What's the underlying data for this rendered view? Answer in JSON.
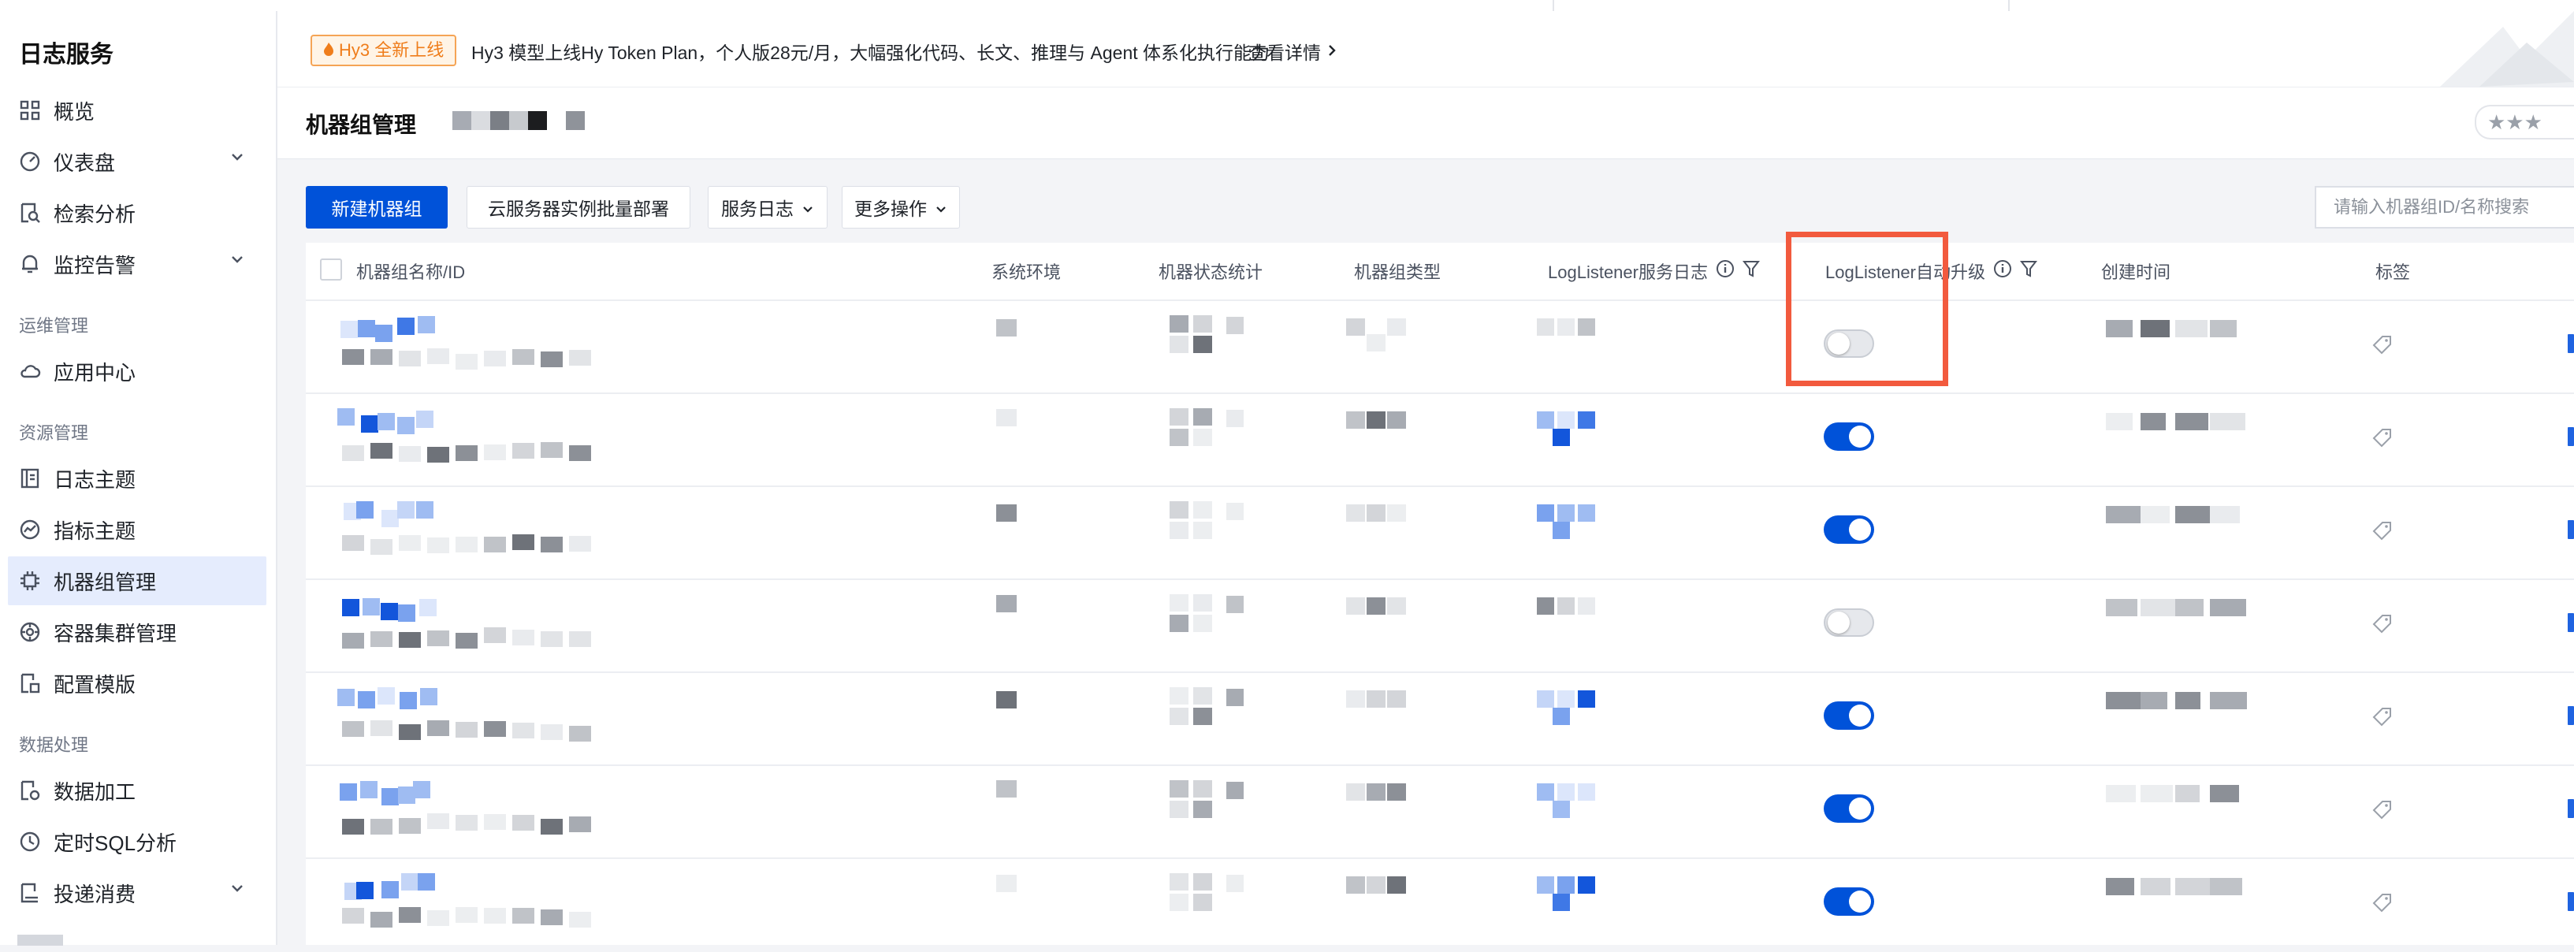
{
  "sidebar": {
    "title": "日志服务",
    "items": [
      {
        "label": "概览",
        "icon": "grid-icon"
      },
      {
        "label": "仪表盘",
        "icon": "gauge-icon",
        "expandable": true
      },
      {
        "label": "检索分析",
        "icon": "doc-search-icon"
      },
      {
        "label": "监控告警",
        "icon": "bell-icon",
        "expandable": true
      }
    ],
    "section_ops": "运维管理",
    "ops_items": [
      {
        "label": "应用中心",
        "icon": "cloud-icon"
      }
    ],
    "section_resource": "资源管理",
    "resource_items": [
      {
        "label": "日志主题",
        "icon": "doc-icon"
      },
      {
        "label": "指标主题",
        "icon": "trend-icon"
      },
      {
        "label": "机器组管理",
        "icon": "chip-icon",
        "active": true
      },
      {
        "label": "容器集群管理",
        "icon": "cog-icon"
      },
      {
        "label": "配置模版",
        "icon": "template-icon"
      }
    ],
    "section_data": "数据处理",
    "data_items": [
      {
        "label": "数据加工",
        "icon": "doc-gear-icon"
      },
      {
        "label": "定时SQL分析",
        "icon": "clock-icon"
      },
      {
        "label": "投递消费",
        "icon": "export-icon",
        "expandable": true
      }
    ]
  },
  "banner": {
    "badge": "Hy3 全新上线",
    "text": "Hy3 模型上线Hy Token Plan，个人版28元/月，大幅强化代码、长文、推理与 Agent 体系化执行能力",
    "link": "查看详情"
  },
  "header": {
    "title": "机器组管理",
    "rating_stars": "★★★"
  },
  "toolbar": {
    "create": "新建机器组",
    "batch_deploy": "云服务器实例批量部署",
    "service_log": "服务日志",
    "more": "更多操作",
    "search_placeholder": "请输入机器组ID/名称搜索"
  },
  "table": {
    "columns": {
      "name": "机器组名称/ID",
      "env": "系统环境",
      "status": "机器状态统计",
      "type": "机器组类型",
      "service_log": "LogListener服务日志",
      "auto_upgrade": "LogListener自动升级",
      "created": "创建时间",
      "tags": "标签"
    },
    "rows": [
      {
        "auto_upgrade": false
      },
      {
        "auto_upgrade": true
      },
      {
        "auto_upgrade": true
      },
      {
        "auto_upgrade": false
      },
      {
        "auto_upgrade": true
      },
      {
        "auto_upgrade": true
      },
      {
        "auto_upgrade": true
      }
    ]
  },
  "colors": {
    "primary": "#0052d9",
    "highlight": "#f25a3e",
    "badge_text": "#ef7d1b"
  }
}
